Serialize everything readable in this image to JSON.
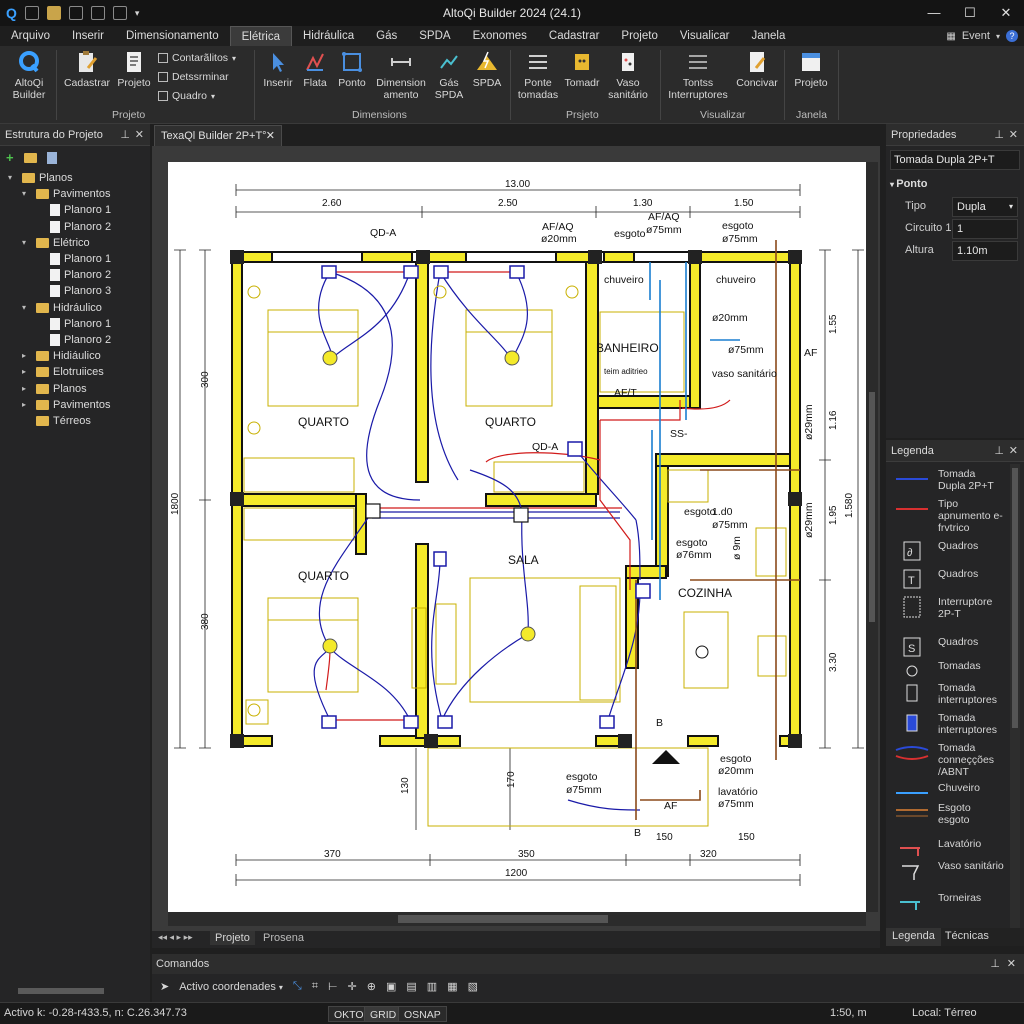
{
  "app": {
    "title": "AltoQi Builder 2024 (24.1)",
    "min": "—",
    "max": "☐",
    "close": "✕"
  },
  "menu": {
    "items": [
      "Arquivo",
      "Inserir",
      "Dimensionamento",
      "Elétrica",
      "Hidráulica",
      "Gás",
      "SPDA",
      "Exonomes",
      "Cadastrar",
      "Projeto",
      "Visualicar",
      "Janela"
    ],
    "event_label": "Event"
  },
  "ribbon": {
    "buttons": {
      "altoqi": "AltoQi Builder",
      "cadastrar": "Cadastrar",
      "projeto": "Projeto",
      "inserir": "Inserir",
      "flata": "Flata",
      "ponto": "Ponto",
      "dimension": "Dimension amento",
      "gas_spda": "Gás SPDA",
      "spda": "SPDA",
      "ponte": "Ponte tomadas",
      "tomadr": "Tomadr",
      "vaso": "Vaso sanitário",
      "tontss": "Tontss Interruptores",
      "concivar": "Concivar",
      "projeto2": "Projeto"
    },
    "small": {
      "contarulitos": "Contarãlitos",
      "detssrminar": "Detssrminar",
      "quadro": "Quadro"
    },
    "groups": {
      "projeto": "Projeto",
      "dimensions": "Dimensions",
      "prsjeto": "Prsjeto",
      "visualizar": "Visualizar",
      "janela": "Janela"
    }
  },
  "structure": {
    "title": "Estrutura do Projeto",
    "tree": [
      {
        "label": "Planos",
        "level": 0,
        "kind": "folder",
        "arrow": "▾"
      },
      {
        "label": "Pavimentos",
        "level": 1,
        "kind": "folder",
        "arrow": "▾"
      },
      {
        "label": "Planoro 1",
        "level": 2,
        "kind": "page",
        "arrow": ""
      },
      {
        "label": "Planoro 2",
        "level": 2,
        "kind": "page",
        "arrow": ""
      },
      {
        "label": "Elétrico",
        "level": 1,
        "kind": "folder",
        "arrow": "▾"
      },
      {
        "label": "Planoro 1",
        "level": 2,
        "kind": "page",
        "arrow": ""
      },
      {
        "label": "Planoro 2",
        "level": 2,
        "kind": "page",
        "arrow": ""
      },
      {
        "label": "Planoro 3",
        "level": 2,
        "kind": "page",
        "arrow": ""
      },
      {
        "label": "Hidráulico",
        "level": 1,
        "kind": "folder",
        "arrow": "▾"
      },
      {
        "label": "Planoro 1",
        "level": 2,
        "kind": "page",
        "arrow": ""
      },
      {
        "label": "Planoro 2",
        "level": 2,
        "kind": "page",
        "arrow": ""
      },
      {
        "label": "Hidiáulico",
        "level": 1,
        "kind": "folder",
        "arrow": "▸"
      },
      {
        "label": "Elotruiices",
        "level": 1,
        "kind": "folder",
        "arrow": "▸"
      },
      {
        "label": "Planos",
        "level": 1,
        "kind": "folder",
        "arrow": "▸"
      },
      {
        "label": "Pavimentos",
        "level": 1,
        "kind": "folder",
        "arrow": "▸"
      },
      {
        "label": "Térreos",
        "level": 1,
        "kind": "folder",
        "arrow": ""
      }
    ]
  },
  "document": {
    "tab_label": "TexaQl Builder 2P+T°",
    "tab_close": "✕"
  },
  "plan": {
    "rooms": [
      "QUARTO",
      "QUARTO",
      "QUARTO",
      "SALA",
      "COZINHA",
      "BANHEIRO"
    ],
    "dims_top": [
      "13.00",
      "2.60",
      "2.50",
      "1.30",
      "1.50"
    ],
    "dims_bottom": [
      "370",
      "350",
      "150",
      "320",
      "1200",
      "150"
    ],
    "dims_left": [
      "300",
      "1800",
      "380",
      "130",
      "170"
    ],
    "dims_right": [
      "1.55",
      "1.16",
      "1.95",
      "1.580",
      "3.30"
    ],
    "labels": {
      "qda": "QD-A",
      "qda2": "QD-A",
      "afaq": "AF/AQ",
      "afaq_d": "ø20mm",
      "afaq2": "AF/AQ",
      "esgoto1": "esgoto",
      "esgoto1_d": "ø75mm",
      "esgoto2": "esgoto",
      "esgoto2_d": "ø75mm",
      "chuveiro1": "chuveiro",
      "chuveiro2": "chuveiro",
      "d20": "ø20mm",
      "d75": "ø75mm",
      "vaso": "vaso sanitário",
      "af": "AF",
      "af2": "AF/T",
      "teim": "teim aditrieo",
      "ss": "SS-",
      "esgoto3": "esgoto",
      "esgoto3_d": "ø75mm",
      "esgoto4": "esgoto",
      "esgoto4_d": "ø76mm",
      "d100": "1.d0",
      "esgoto5": "esgoto",
      "esgoto5_d": "ø20mm",
      "esgoto6": "esgoto",
      "esgoto6_d": "ø75mm",
      "lavatorio": "lavatório",
      "lavatorio_d": "ø75mm",
      "af3": "AF",
      "b1": "B",
      "b2": "B",
      "d9": "ø 9m",
      "d29a": "ø29mm",
      "d29b": "ø29mm"
    }
  },
  "properties": {
    "title": "Propriedades",
    "selected": "Tomada Dupla 2P+T",
    "section": "Ponto",
    "rows": [
      {
        "key": "Tipo",
        "value": "Dupla"
      },
      {
        "key": "Circuito 1",
        "value": "1"
      },
      {
        "key": "Altura",
        "value": "1.10m"
      }
    ]
  },
  "legend": {
    "title": "Legenda",
    "items": [
      "Tomada Dupla 2P+T",
      "Tipo apnumento e-frvtrico",
      "Quadros",
      "Quadros",
      "Interruptore 2P-T",
      "Quadros",
      "Tomadas",
      "Tomada interruptores",
      "Tomada interruptores",
      "Tomada conneçções /ABNT",
      "Chuveiro",
      "Esgoto esgoto",
      "Lavatório",
      "Vaso sanitário",
      "Torneiras"
    ],
    "tabs": [
      "Legenda",
      "Técnicas"
    ]
  },
  "sheets": [
    "Projeto",
    "Prosena"
  ],
  "commands": {
    "title": "Comandos",
    "mode": "Activo coordenades"
  },
  "status": {
    "coords": "Activo k: -0.28-r433.5, n: C.26.347.73",
    "okto": "OKTO",
    "grid": "GRID",
    "osnap": "OSNAP",
    "scale": "1:50, m",
    "local": "Local: Térreo"
  },
  "colors": {
    "wall": "#f4ea2a",
    "elec_blue": "#1a1aa8",
    "elec_red": "#d11a1a",
    "water": "#1a7fd1",
    "sewer": "#8b4a1a"
  }
}
